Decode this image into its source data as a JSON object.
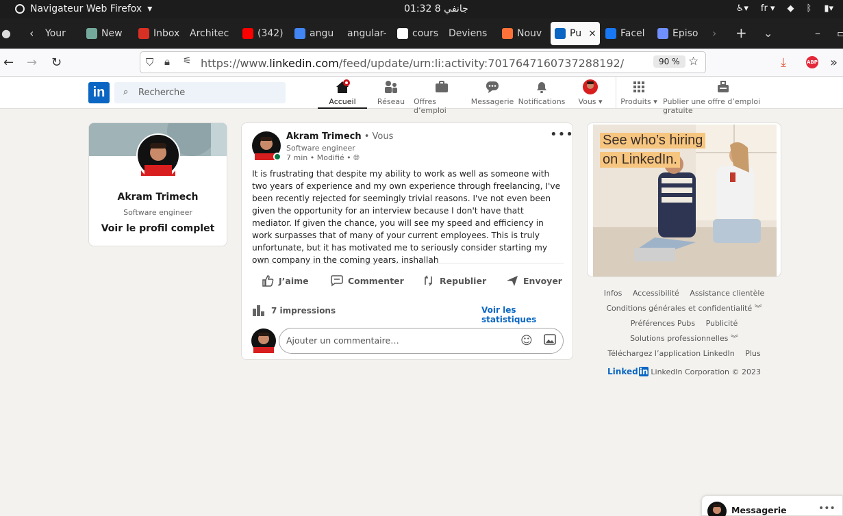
{
  "system": {
    "app_name": "Navigateur Web Firefox",
    "clock": "01:32  جانفي 8",
    "lang": "fr"
  },
  "tabs": [
    {
      "label": "Your",
      "color": "#d8d8d8"
    },
    {
      "label": "New",
      "color": "#74aa9c"
    },
    {
      "label": "Inbox",
      "color": "#d93025"
    },
    {
      "label": "Architec",
      "color": "#cccccc"
    },
    {
      "label": "(342)",
      "color": "#ff0000"
    },
    {
      "label": "angu",
      "color": "#4285f4"
    },
    {
      "label": "angular-",
      "color": "#cccccc"
    },
    {
      "label": "cours",
      "color": "#ffffff"
    },
    {
      "label": "Deviens",
      "color": "#cccccc"
    },
    {
      "label": "Nouv",
      "color": "#ff7139"
    },
    {
      "label": "Pu",
      "color": "#0a66c2"
    },
    {
      "label": "Facel",
      "color": "#1877f2"
    },
    {
      "label": "Episo",
      "color": "#7090ff"
    }
  ],
  "browser": {
    "url_prefix": "https://www.",
    "url_domain": "linkedin.com",
    "url_path": "/feed/update/urn:li:activity:7017647160737288192/",
    "zoom": "90 %"
  },
  "linkedin": {
    "logo": "in",
    "search_placeholder": "Recherche",
    "nav": [
      {
        "label": "Accueil"
      },
      {
        "label": "Réseau"
      },
      {
        "label": "Offres d’emploi"
      },
      {
        "label": "Messagerie"
      },
      {
        "label": "Notifications"
      },
      {
        "label": "Vous ▾"
      },
      {
        "label": "Produits ▾"
      },
      {
        "label": "Publier une offre d’emploi gratuite"
      }
    ]
  },
  "profile": {
    "name": "Akram Trimech",
    "title": "Software engineer",
    "link": "Voir le profil complet"
  },
  "post": {
    "author": "Akram Trimech",
    "you": " • Vous",
    "subtitle": "Software engineer",
    "meta": "7 min • Modifié •",
    "text": "It is frustrating that despite my ability to work as well as someone with two years of experience and my own experience through freelancing, I've been recently rejected for seemingly trivial reasons. I've not even been given the opportunity for an interview because I don't have thatt mediator. If given the chance, you will see my speed and efficiency in work surpasses that of many of your current employees. This is truly unfortunate, but it has motivated me to seriously consider starting my own company in the coming years, inshallah",
    "actions": {
      "like": "J’aime",
      "comment": "Commenter",
      "repost": "Republier",
      "send": "Envoyer"
    },
    "impressions": "7 impressions",
    "stats_link": "Voir les statistiques",
    "comment_placeholder": "Ajouter un commentaire…"
  },
  "ad": {
    "line1": "See who’s hiring",
    "line2": "on LinkedIn."
  },
  "footer": {
    "row1": [
      "Infos",
      "Accessibilité",
      "Assistance clientèle"
    ],
    "row2": [
      "Conditions générales et confidentialité ︾"
    ],
    "row3": [
      "Préférences Pubs",
      "Publicité"
    ],
    "row4": [
      "Solutions professionnelles ︾"
    ],
    "row5": [
      "Téléchargez l’application LinkedIn",
      "Plus"
    ],
    "brand": "Linked",
    "brand_in": "in",
    "copyright": "LinkedIn Corporation © 2023"
  },
  "messaging": {
    "label": "Messagerie",
    "dots": "•••"
  }
}
